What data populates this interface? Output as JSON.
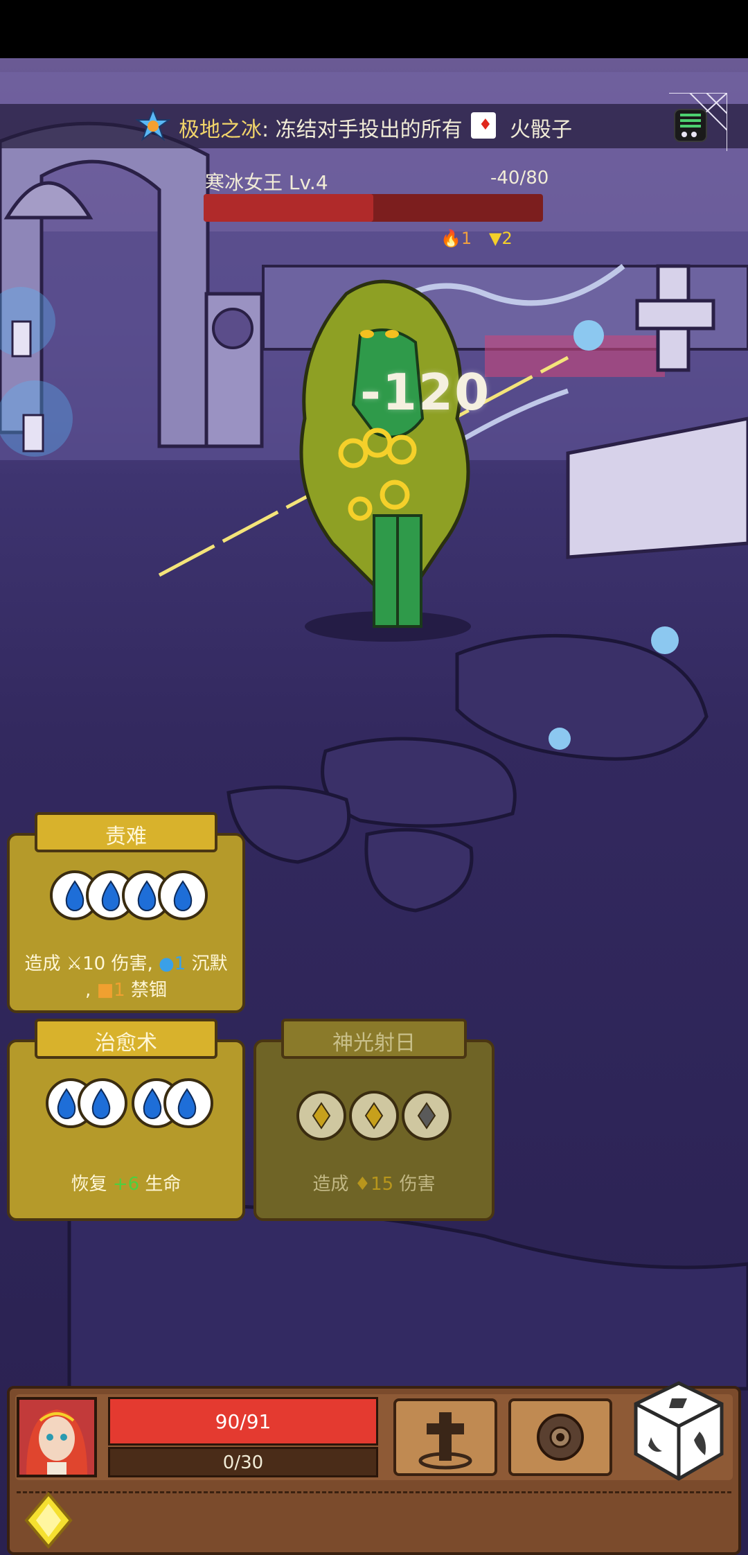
{
  "banner": {
    "skill_name": "极地之冰",
    "separator": ":",
    "skill_desc": "冻结对手投出的所有",
    "dice_label": "火骰子"
  },
  "enemy": {
    "name": "寒冰女王",
    "level": "Lv.4",
    "hp_text": "-40/80",
    "hp_fraction": 0.5,
    "status": [
      {
        "icon": "fire-icon",
        "count": "1"
      },
      {
        "icon": "triangle-icon",
        "count": "2"
      }
    ]
  },
  "damage_float": "-120",
  "cards": [
    {
      "title": "责难",
      "desc_line1_prefix": "造成",
      "desc_dmg": "10",
      "desc_dmg_suffix": "伤害,",
      "desc_silence": "1",
      "desc_silence_suffix": "沉默",
      "desc_line2_prefix": ",",
      "desc_lock": "1",
      "desc_lock_suffix": "禁锢",
      "slots": [
        "water",
        "water",
        "water",
        "water"
      ]
    },
    {
      "title": "治愈术",
      "desc_prefix": "恢复",
      "desc_value": "+6",
      "desc_suffix": "生命",
      "slots": [
        "water-pair",
        "water-pair"
      ]
    },
    {
      "title": "神光射日",
      "desc_prefix": "造成",
      "desc_value": "15",
      "desc_suffix": "伤害",
      "slots": [
        "gold",
        "gold",
        "gray"
      ]
    }
  ],
  "player": {
    "hp_text": "90/91",
    "hp_fraction": 0.989,
    "shield_text": "0/30",
    "shield_fraction": 0
  },
  "icons": {
    "menu": "menu-list-icon",
    "dice": "dice-icon",
    "item1": "cross-tombstone-icon",
    "item2": "urn-icon",
    "gem": "lightning-gem-icon"
  },
  "colors": {
    "card_gold": "#b59a2a",
    "hp_red": "#e43a30",
    "water_blue": "#1e6ed8"
  }
}
